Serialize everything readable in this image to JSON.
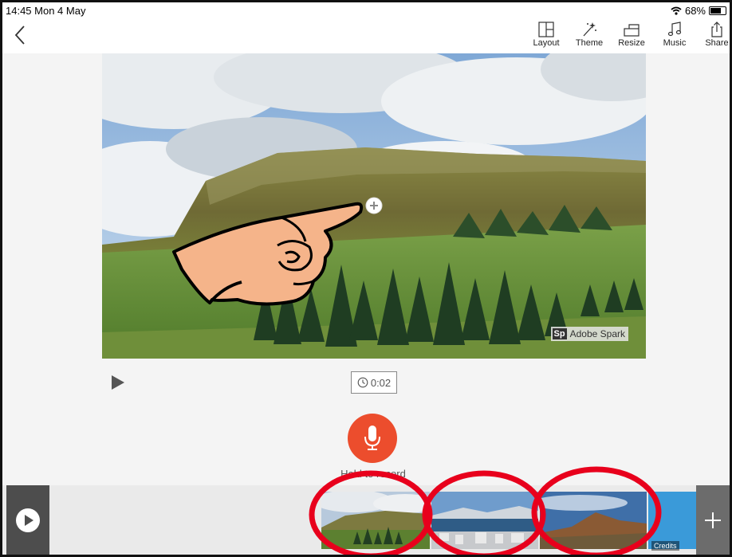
{
  "status_bar": {
    "time_date": "14:45  Mon 4 May",
    "battery": "68%",
    "icons": [
      "wifi-icon",
      "battery-icon"
    ]
  },
  "toolbar": {
    "back_icon": "chevron-left-icon",
    "tools": [
      {
        "label": "Layout",
        "icon": "layout-icon"
      },
      {
        "label": "Theme",
        "icon": "magic-wand-icon"
      },
      {
        "label": "Resize",
        "icon": "resize-icon"
      },
      {
        "label": "Music",
        "icon": "music-note-icon"
      },
      {
        "label": "Share",
        "icon": "share-icon"
      }
    ]
  },
  "slide": {
    "watermark_logo": "Sp",
    "watermark_text": "Adobe Spark",
    "add_icon": "plus-circle-icon"
  },
  "controls": {
    "play_icon": "play-icon",
    "duration": "0:02",
    "duration_icon": "clock-icon",
    "mic_icon": "microphone-icon",
    "hold_label": "Hold to record"
  },
  "filmstrip": {
    "play_icon": "play-circle-icon",
    "add_icon": "plus-icon",
    "slides": [
      "landscape-cliff-thumbnail",
      "city-harbor-thumbnail",
      "volcano-hill-thumbnail",
      "credits-slide"
    ],
    "credits_label": "Credits"
  },
  "colors": {
    "mic_red": "#ec4d2d",
    "annotation_red": "#e8001c",
    "filmstrip_dark": "#4d4d4d",
    "credits_blue": "#3a9ad9"
  }
}
